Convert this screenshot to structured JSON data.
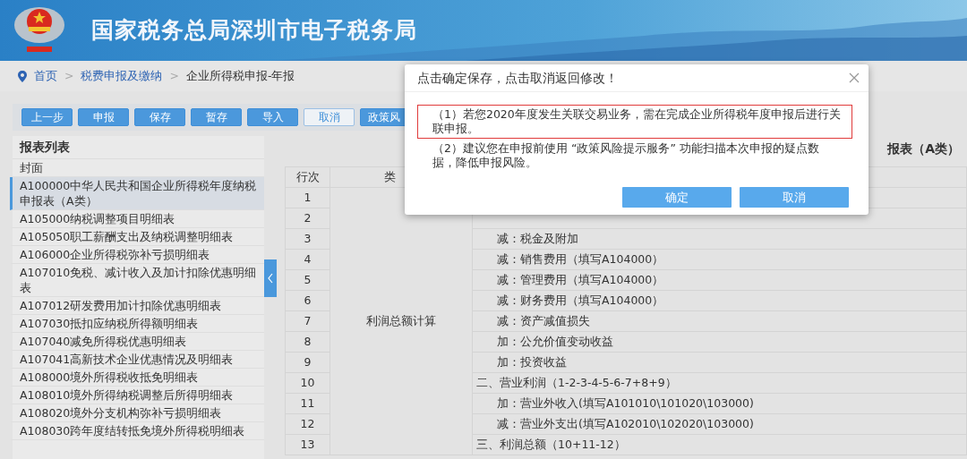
{
  "header": {
    "title": "国家税务总局深圳市电子税务局"
  },
  "breadcrumb": [
    {
      "label": "首页",
      "kind": "home"
    },
    {
      "label": "税费申报及缴纳",
      "kind": "link",
      "separator": ">"
    },
    {
      "label": "企业所得税申报-年报",
      "kind": "current",
      "separator": ">"
    }
  ],
  "toolbar": [
    {
      "label": "上一步",
      "kind": "primary"
    },
    {
      "label": "申报",
      "kind": "primary"
    },
    {
      "label": "保存",
      "kind": "primary"
    },
    {
      "label": "暂存",
      "kind": "primary"
    },
    {
      "label": "导入",
      "kind": "primary"
    },
    {
      "label": "取消",
      "kind": "outline"
    },
    {
      "label": "政策风",
      "kind": "primary"
    }
  ],
  "sidebar": {
    "title": "报表列表",
    "items": [
      {
        "label": "封面",
        "selected": false
      },
      {
        "label": "A100000中华人民共和国企业所得税年度纳税申报表（A类）",
        "selected": true
      },
      {
        "label": "A105000纳税调整项目明细表",
        "selected": false
      },
      {
        "label": "A105050职工薪酬支出及纳税调整明细表",
        "selected": false
      },
      {
        "label": "A106000企业所得税弥补亏损明细表",
        "selected": false
      },
      {
        "label": "A107010免税、减计收入及加计扣除优惠明细表",
        "selected": false
      },
      {
        "label": "A107012研发费用加计扣除优惠明细表",
        "selected": false
      },
      {
        "label": "A107030抵扣应纳税所得额明细表",
        "selected": false
      },
      {
        "label": "A107040减免所得税优惠明细表",
        "selected": false
      },
      {
        "label": "A107041高新技术企业优惠情况及明细表",
        "selected": false
      },
      {
        "label": "A108000境外所得税收抵免明细表",
        "selected": false
      },
      {
        "label": "A108010境外所得纳税调整后所得明细表",
        "selected": false
      },
      {
        "label": "A108020境外分支机构弥补亏损明细表",
        "selected": false
      },
      {
        "label": "A108030跨年度结转抵免境外所得税明细表",
        "selected": false
      }
    ]
  },
  "form": {
    "title": "报表（A类）",
    "columns": [
      "行次",
      "类"
    ],
    "category": "利润总额计算",
    "rows": [
      {
        "no": "1"
      },
      {
        "no": "2"
      },
      {
        "no": "3",
        "item": "减：税金及附加",
        "kind": "sub"
      },
      {
        "no": "4",
        "item": "减：销售费用（填写A104000）",
        "kind": "sub"
      },
      {
        "no": "5",
        "item": "减：管理费用（填写A104000）",
        "kind": "sub"
      },
      {
        "no": "6",
        "item": "减：财务费用（填写A104000）",
        "kind": "sub"
      },
      {
        "no": "7",
        "item": "减：资产减值损失",
        "kind": "sub"
      },
      {
        "no": "8",
        "item": "加：公允价值变动收益",
        "kind": "sub"
      },
      {
        "no": "9",
        "item": "加：投资收益",
        "kind": "sub"
      },
      {
        "no": "10",
        "item": "二、营业利润（1-2-3-4-5-6-7+8+9）",
        "kind": "main"
      },
      {
        "no": "11",
        "item": "加：营业外收入(填写A101010\\101020\\103000)",
        "kind": "sub"
      },
      {
        "no": "12",
        "item": "减：营业外支出(填写A102010\\102020\\103000)",
        "kind": "sub"
      },
      {
        "no": "13",
        "item": "三、利润总额（10+11-12）",
        "kind": "main"
      }
    ]
  },
  "dialog": {
    "title": "点击确定保存，点击取消返回修改！",
    "messages": [
      {
        "text": "（1）若您2020年度发生关联交易业务，需在完成企业所得税年度申报后进行关联申报。",
        "highlighted": true
      },
      {
        "text": "（2）建议您在申报前使用 “政策风险提示服务” 功能扫描本次申报的疑点数据，降低申报风险。",
        "highlighted": false
      }
    ],
    "buttons": [
      "确定",
      "取消"
    ]
  }
}
